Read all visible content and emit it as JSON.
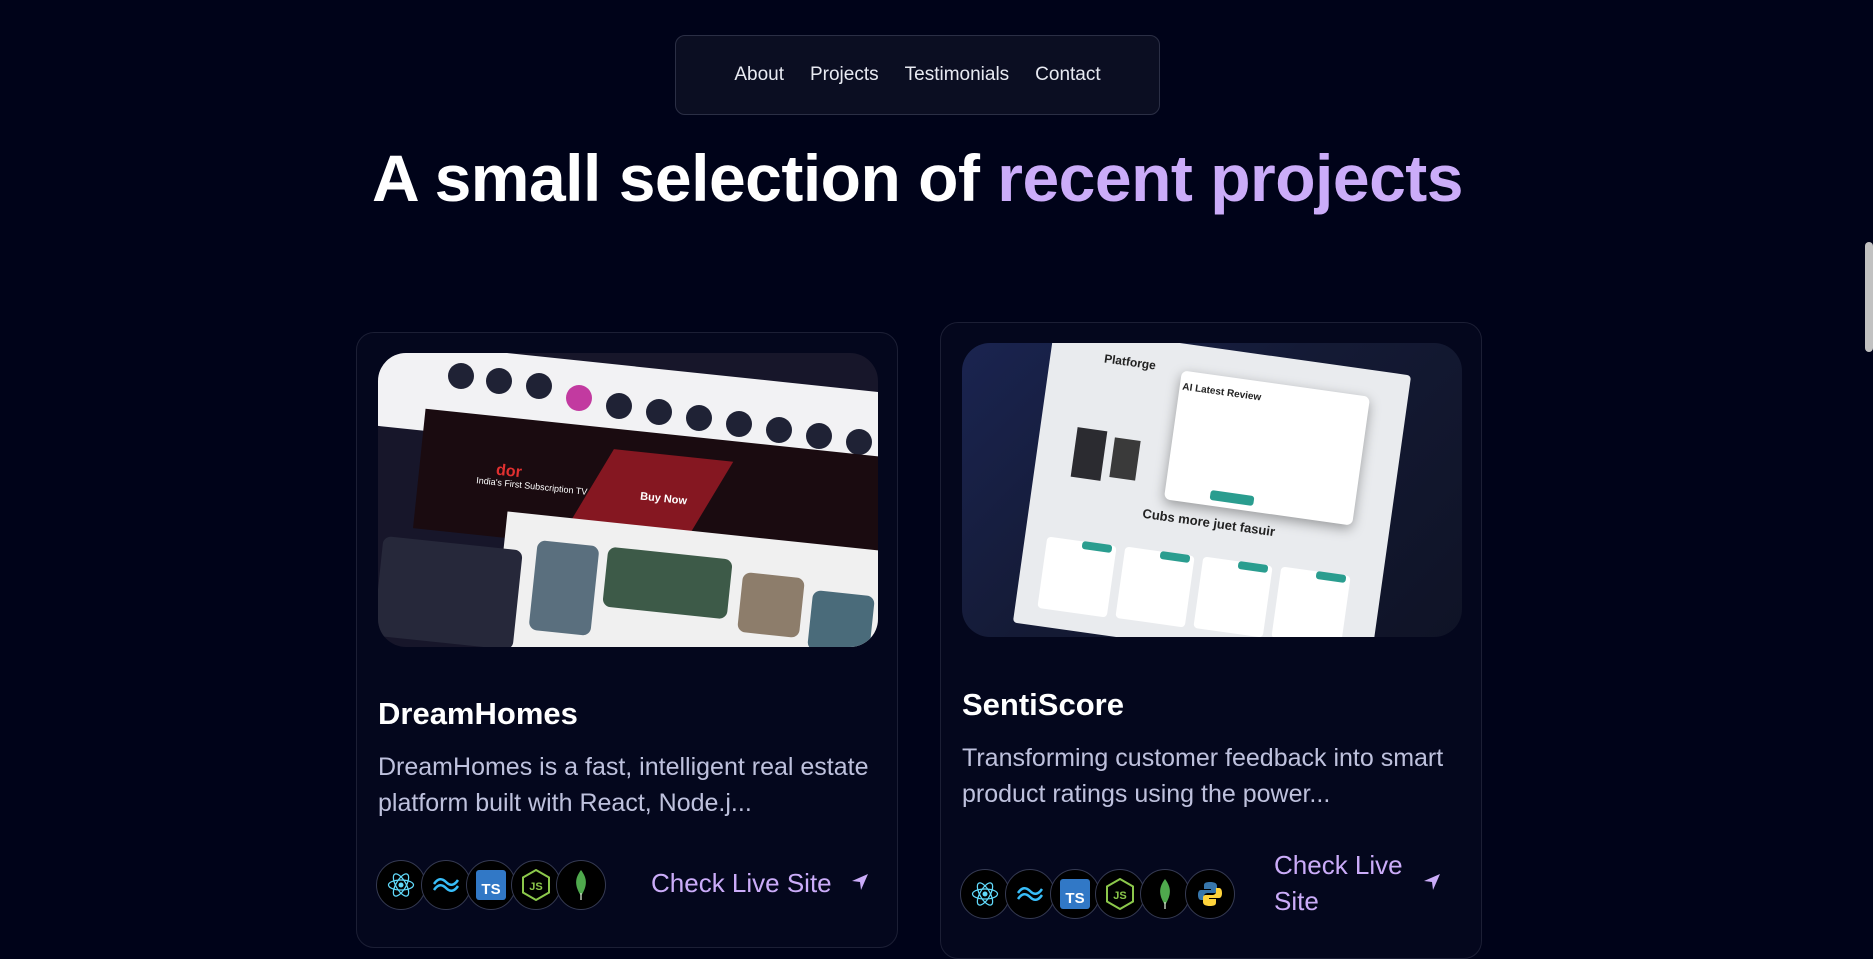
{
  "nav": {
    "items": [
      "About",
      "Projects",
      "Testimonials",
      "Contact"
    ]
  },
  "heading": {
    "main": "A small selection of",
    "accent": "recent projects"
  },
  "projects": [
    {
      "title": "DreamHomes",
      "description": "DreamHomes is a fast, intelligent real estate platform built with React, Node.j...",
      "tech_icons": [
        "react-icon",
        "tailwind-icon",
        "typescript-icon",
        "nodejs-icon",
        "mongodb-icon"
      ],
      "link_label": "Check Live Site",
      "thumb_text": {
        "headline": "India's First Subscription TV",
        "brand": "dor",
        "cta": "Buy Now"
      }
    },
    {
      "title": "SentiScore",
      "description": "Transforming customer feedback into smart product ratings using the power...",
      "tech_icons": [
        "react-icon",
        "tailwind-icon",
        "typescript-icon",
        "nodejs-icon",
        "mongodb-icon",
        "python-icon"
      ],
      "link_label": "Check Live Site",
      "thumb_text": {
        "app": "Platforge",
        "modal_title": "AI Latest Review",
        "section": "Cubs more juet fasuir"
      }
    }
  ],
  "colors": {
    "background": "#000319",
    "accent": "#cbacf9",
    "card_border": "#1c1f35"
  }
}
